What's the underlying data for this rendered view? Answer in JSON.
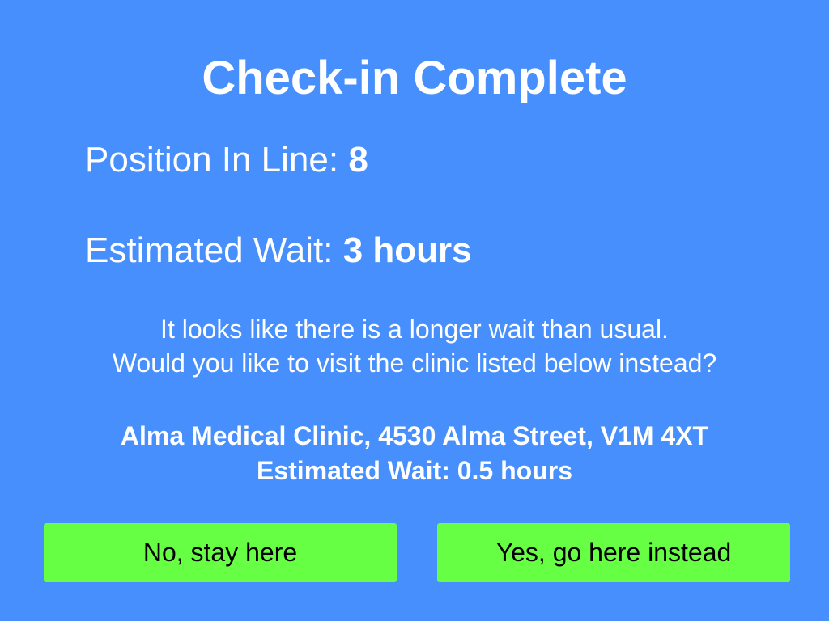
{
  "title": "Check-in Complete",
  "position": {
    "label": "Position In Line: ",
    "value": "8"
  },
  "wait": {
    "label": "Estimated Wait: ",
    "value": "3 hours"
  },
  "message": {
    "line1": "It looks like there is a longer wait than usual.",
    "line2": "Would you like to visit the clinic listed below instead?"
  },
  "alternative_clinic": {
    "address": "Alma Medical Clinic, 4530 Alma Street, V1M 4XT",
    "wait": "Estimated Wait: 0.5 hours"
  },
  "buttons": {
    "stay": "No, stay here",
    "go": "Yes, go here instead"
  },
  "colors": {
    "background": "#478ffd",
    "button": "#66ff44",
    "text": "#ffffff",
    "button_text": "#000000"
  }
}
